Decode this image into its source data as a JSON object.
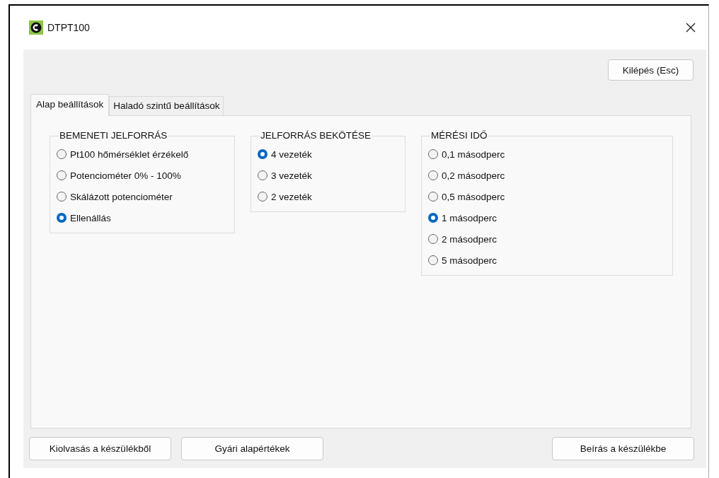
{
  "window": {
    "title": "DTPT100"
  },
  "exit_button": "Kilépés (Esc)",
  "tabs": [
    {
      "label": "Alap beállítások",
      "selected": true
    },
    {
      "label": "Haladó szintű beállítások",
      "selected": false
    }
  ],
  "groups": [
    {
      "title": "BEMENETI JELFORRÁS",
      "options": [
        {
          "label": "Pt100 hőmérséklet érzékelő",
          "selected": false
        },
        {
          "label": "Potenciométer 0% - 100%",
          "selected": false
        },
        {
          "label": "Skálázott potenciométer",
          "selected": false
        },
        {
          "label": "Ellenállás",
          "selected": true
        }
      ]
    },
    {
      "title": "JELFORRÁS BEKÖTÉSE",
      "options": [
        {
          "label": "4 vezeték",
          "selected": true
        },
        {
          "label": "3 vezeték",
          "selected": false
        },
        {
          "label": "2 vezeték",
          "selected": false
        }
      ]
    },
    {
      "title": "MÉRÉSI IDŐ",
      "options": [
        {
          "label": "0,1 másodperc",
          "selected": false
        },
        {
          "label": "0,2 másodperc",
          "selected": false
        },
        {
          "label": "0,5 másodperc",
          "selected": false
        },
        {
          "label": "1 másodperc",
          "selected": true
        },
        {
          "label": "2 másodperc",
          "selected": false
        },
        {
          "label": "5 másodperc",
          "selected": false
        }
      ]
    }
  ],
  "bottom_buttons_left": [
    "Kiolvasás a készülékből",
    "Gyári alapértékek"
  ],
  "bottom_buttons_right": [
    "Beírás a készülékbe"
  ]
}
